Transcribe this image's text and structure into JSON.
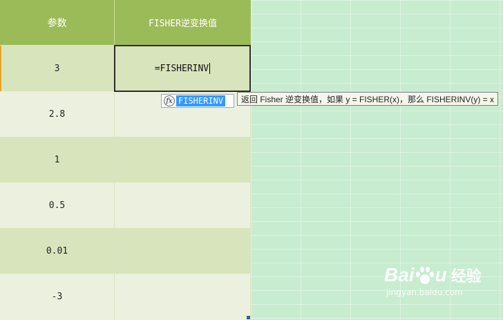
{
  "sheet": {
    "headers": [
      "参数",
      "FISHER逆变换值"
    ],
    "params": [
      "3",
      "2.8",
      "1",
      "0.5",
      "0.01",
      "-3"
    ]
  },
  "editing": {
    "formula": "=FISHERINV"
  },
  "autocomplete": {
    "icon_glyph": "fx",
    "item": "FISHERINV"
  },
  "tooltip": {
    "text": "返回 Fisher 逆变换值，如果 y = FISHER(x)，那么 FISHERINV(y) = x"
  },
  "watermark": {
    "logo_a": "Bai",
    "logo_b": "u",
    "logo_cn": "经验",
    "url": "jingyan.baidu.com"
  },
  "colors": {
    "header": "#9bbb59",
    "row_dark": "#d8e4bc",
    "row_light": "#ebf1de",
    "background": "#c8ecd0",
    "selection": "#3399ff"
  }
}
